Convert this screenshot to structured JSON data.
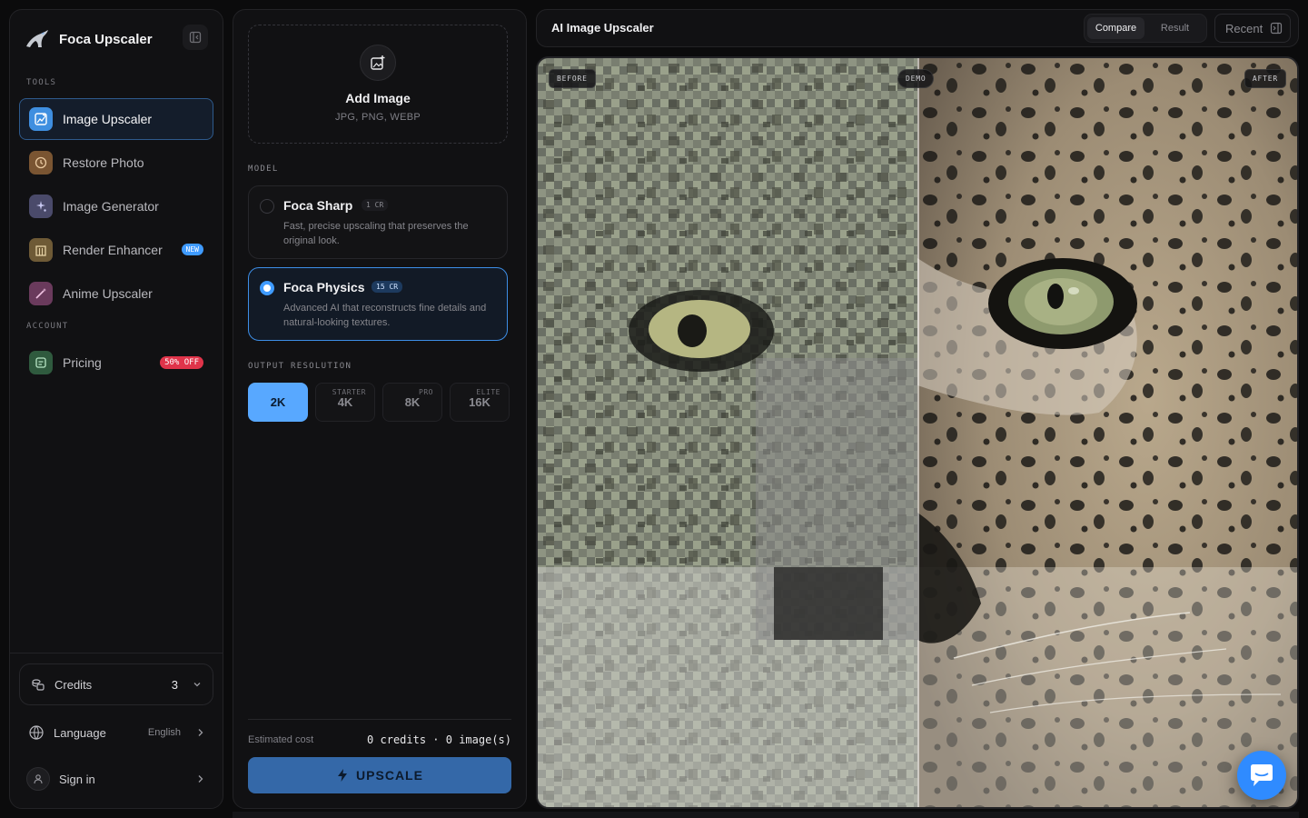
{
  "app": {
    "name": "Foca Upscaler"
  },
  "sidebar": {
    "tools_label": "TOOLS",
    "account_label": "ACCOUNT",
    "items": [
      {
        "label": "Image Upscaler",
        "icon": "image-upscale-icon",
        "active": true
      },
      {
        "label": "Restore Photo",
        "icon": "restore-icon"
      },
      {
        "label": "Image Generator",
        "icon": "sparkles-icon"
      },
      {
        "label": "Render Enhancer",
        "icon": "building-icon",
        "badge": "NEW"
      },
      {
        "label": "Anime Upscaler",
        "icon": "magic-wand-icon"
      }
    ],
    "pricing": {
      "label": "Pricing",
      "badge": "50% OFF"
    },
    "credits": {
      "label": "Credits",
      "value": "3"
    },
    "language": {
      "label": "Language",
      "value": "English"
    },
    "signin": {
      "label": "Sign in"
    }
  },
  "panel": {
    "dropzone": {
      "title": "Add Image",
      "formats": "JPG, PNG, WEBP"
    },
    "model_label": "MODEL",
    "models": [
      {
        "name": "Foca Sharp",
        "cost": "1 CR",
        "desc": "Fast, precise upscaling that preserves the original look.",
        "selected": false
      },
      {
        "name": "Foca Physics",
        "cost": "15 CR",
        "desc": "Advanced AI that reconstructs fine details and natural-looking textures.",
        "selected": true
      }
    ],
    "resolution_label": "OUTPUT RESOLUTION",
    "resolutions": [
      {
        "value": "2K",
        "tier": "",
        "active": true
      },
      {
        "value": "4K",
        "tier": "STARTER"
      },
      {
        "value": "8K",
        "tier": "PRO"
      },
      {
        "value": "16K",
        "tier": "ELITE"
      }
    ],
    "estimate_label": "Estimated cost",
    "estimate_value": "0 credits · 0 image(s)",
    "upscale_label": "UPSCALE"
  },
  "topbar": {
    "title": "AI Image Upscaler",
    "tabs": [
      "Compare",
      "Result"
    ],
    "active_tab": "Compare",
    "recent_label": "Recent"
  },
  "viewer": {
    "before_tag": "BEFORE",
    "demo_tag": "DEMO",
    "after_tag": "AFTER",
    "split_position": 0.5
  },
  "colors": {
    "accent": "#3f9bff",
    "badge_red": "#e0344a",
    "bg": "#0b0b0c",
    "panel": "#111113"
  }
}
